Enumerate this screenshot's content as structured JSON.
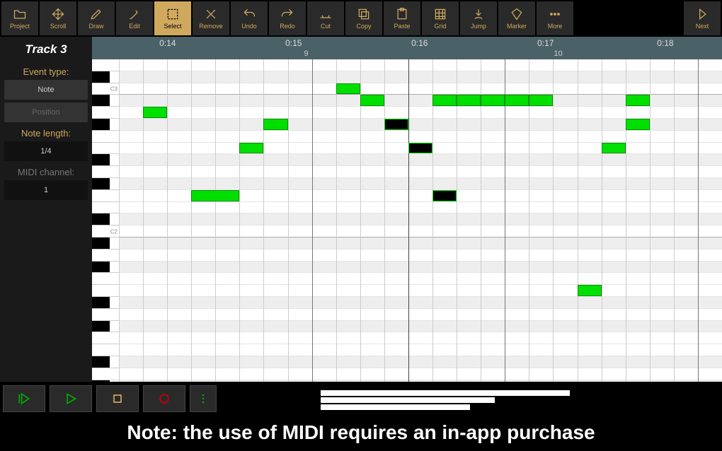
{
  "toolbar": {
    "items": [
      {
        "label": "Project",
        "icon": "folder-icon",
        "selected": false
      },
      {
        "label": "Scroll",
        "icon": "move-icon",
        "selected": false
      },
      {
        "label": "Draw",
        "icon": "pencil-icon",
        "selected": false
      },
      {
        "label": "Edit",
        "icon": "edit-icon",
        "selected": false
      },
      {
        "label": "Select",
        "icon": "select-icon",
        "selected": true
      },
      {
        "label": "Remove",
        "icon": "remove-icon",
        "selected": false
      },
      {
        "label": "Undo",
        "icon": "undo-icon",
        "selected": false
      },
      {
        "label": "Redo",
        "icon": "redo-icon",
        "selected": false
      },
      {
        "label": "Cut",
        "icon": "cut-icon",
        "selected": false
      },
      {
        "label": "Copy",
        "icon": "copy-icon",
        "selected": false
      },
      {
        "label": "Paste",
        "icon": "paste-icon",
        "selected": false
      },
      {
        "label": "Grid",
        "icon": "grid-icon",
        "selected": false
      },
      {
        "label": "Jump",
        "icon": "jump-icon",
        "selected": false
      },
      {
        "label": "Marker",
        "icon": "marker-icon",
        "selected": false
      },
      {
        "label": "More",
        "icon": "more-icon",
        "selected": false
      }
    ],
    "next_label": "Next"
  },
  "sidebar": {
    "title": "Track 3",
    "event_type_label": "Event type:",
    "note_btn": "Note",
    "position_btn": "Position",
    "note_length_label": "Note length:",
    "note_length_value": "1/4",
    "midi_channel_label": "MIDI channel:",
    "midi_channel_value": "1"
  },
  "ruler": {
    "times": [
      {
        "label": "0:14",
        "x": 12
      },
      {
        "label": "0:15",
        "x": 32
      },
      {
        "label": "0:16",
        "x": 52
      },
      {
        "label": "0:17",
        "x": 72
      },
      {
        "label": "0:18",
        "x": 91
      }
    ],
    "bars": [
      {
        "label": "9",
        "x": 34
      },
      {
        "label": "10",
        "x": 74
      }
    ]
  },
  "piano": {
    "top_note_index": 0,
    "row_height": 16.8,
    "black_rows": [
      1,
      3,
      5,
      8,
      10,
      13,
      15,
      17,
      20,
      22,
      25,
      27
    ],
    "labels": [
      {
        "row": 2,
        "text": "C3"
      },
      {
        "row": 14,
        "text": "C2"
      }
    ]
  },
  "notes": [
    {
      "col": 1,
      "row": 4,
      "w": 1,
      "sel": false
    },
    {
      "col": 3,
      "row": 11,
      "w": 2,
      "sel": false
    },
    {
      "col": 5,
      "row": 7,
      "w": 1,
      "sel": false
    },
    {
      "col": 6,
      "row": 5,
      "w": 1,
      "sel": false
    },
    {
      "col": 9,
      "row": 2,
      "w": 1,
      "sel": false
    },
    {
      "col": 10,
      "row": 3,
      "w": 1,
      "sel": false
    },
    {
      "col": 11,
      "row": 5,
      "w": 1,
      "sel": true
    },
    {
      "col": 12,
      "row": 7,
      "w": 1,
      "sel": true
    },
    {
      "col": 13,
      "row": 11,
      "w": 1,
      "sel": true
    },
    {
      "col": 13,
      "row": 3,
      "w": 1,
      "sel": false
    },
    {
      "col": 14,
      "row": 3,
      "w": 1,
      "sel": false
    },
    {
      "col": 15,
      "row": 3,
      "w": 1,
      "sel": false
    },
    {
      "col": 16,
      "row": 3,
      "w": 1,
      "sel": false
    },
    {
      "col": 17,
      "row": 3,
      "w": 1,
      "sel": false
    },
    {
      "col": 20,
      "row": 7,
      "w": 1,
      "sel": false
    },
    {
      "col": 21,
      "row": 3,
      "w": 1,
      "sel": false
    },
    {
      "col": 21,
      "row": 5,
      "w": 1,
      "sel": false
    },
    {
      "col": 19,
      "row": 19,
      "w": 1,
      "sel": false
    }
  ],
  "grid": {
    "cols": 25,
    "bar_cols": [
      8,
      16,
      24
    ],
    "major_cols": [
      12
    ]
  },
  "transport": {},
  "footer": "Note: the use of MIDI requires an in-app purchase"
}
